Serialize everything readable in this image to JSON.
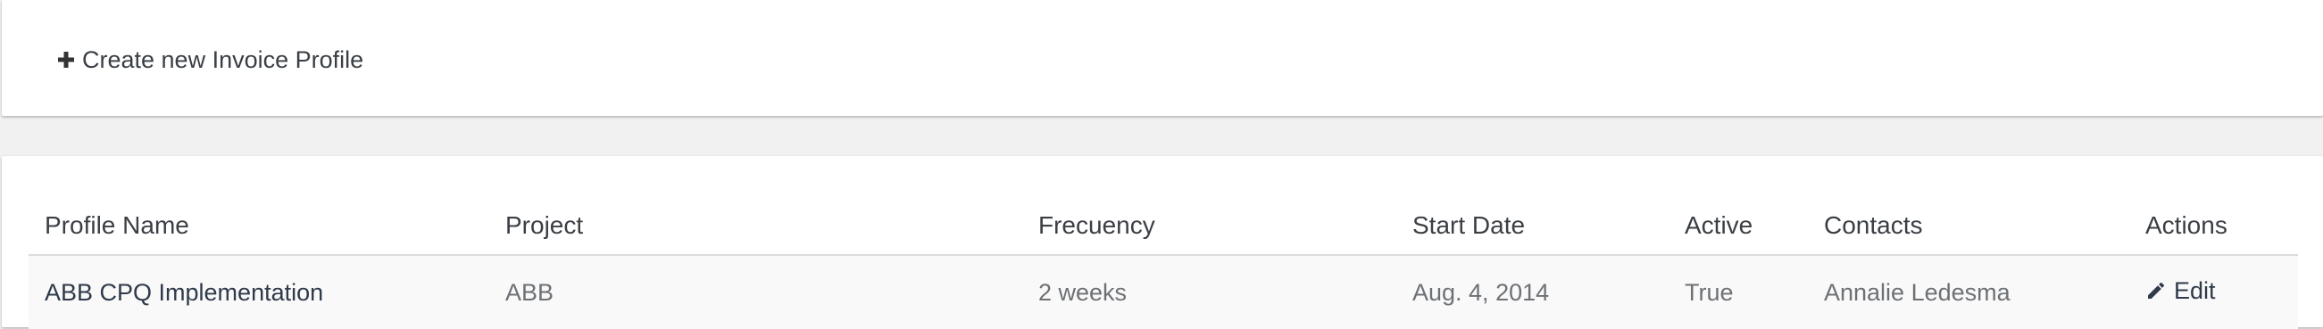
{
  "toolbar": {
    "create_label": "Create new Invoice Profile"
  },
  "table": {
    "headers": {
      "profile_name": "Profile Name",
      "project": "Project",
      "frequency": "Frecuency",
      "start_date": "Start Date",
      "active": "Active",
      "contacts": "Contacts",
      "actions": "Actions"
    },
    "rows": [
      {
        "profile_name": "ABB CPQ Implementation",
        "project": "ABB",
        "frequency": "2 weeks",
        "start_date": "Aug. 4, 2014",
        "active": "True",
        "contacts": "Annalie Ledesma",
        "action_label": "Edit"
      }
    ]
  },
  "icons": {
    "create": "plus-icon",
    "edit": "pencil-icon"
  },
  "colors": {
    "background": "#f1f1f1",
    "panel": "#ffffff",
    "row_background": "#f9f9f9",
    "text_dark": "#2f3a4a",
    "text_muted": "#6d7175"
  }
}
